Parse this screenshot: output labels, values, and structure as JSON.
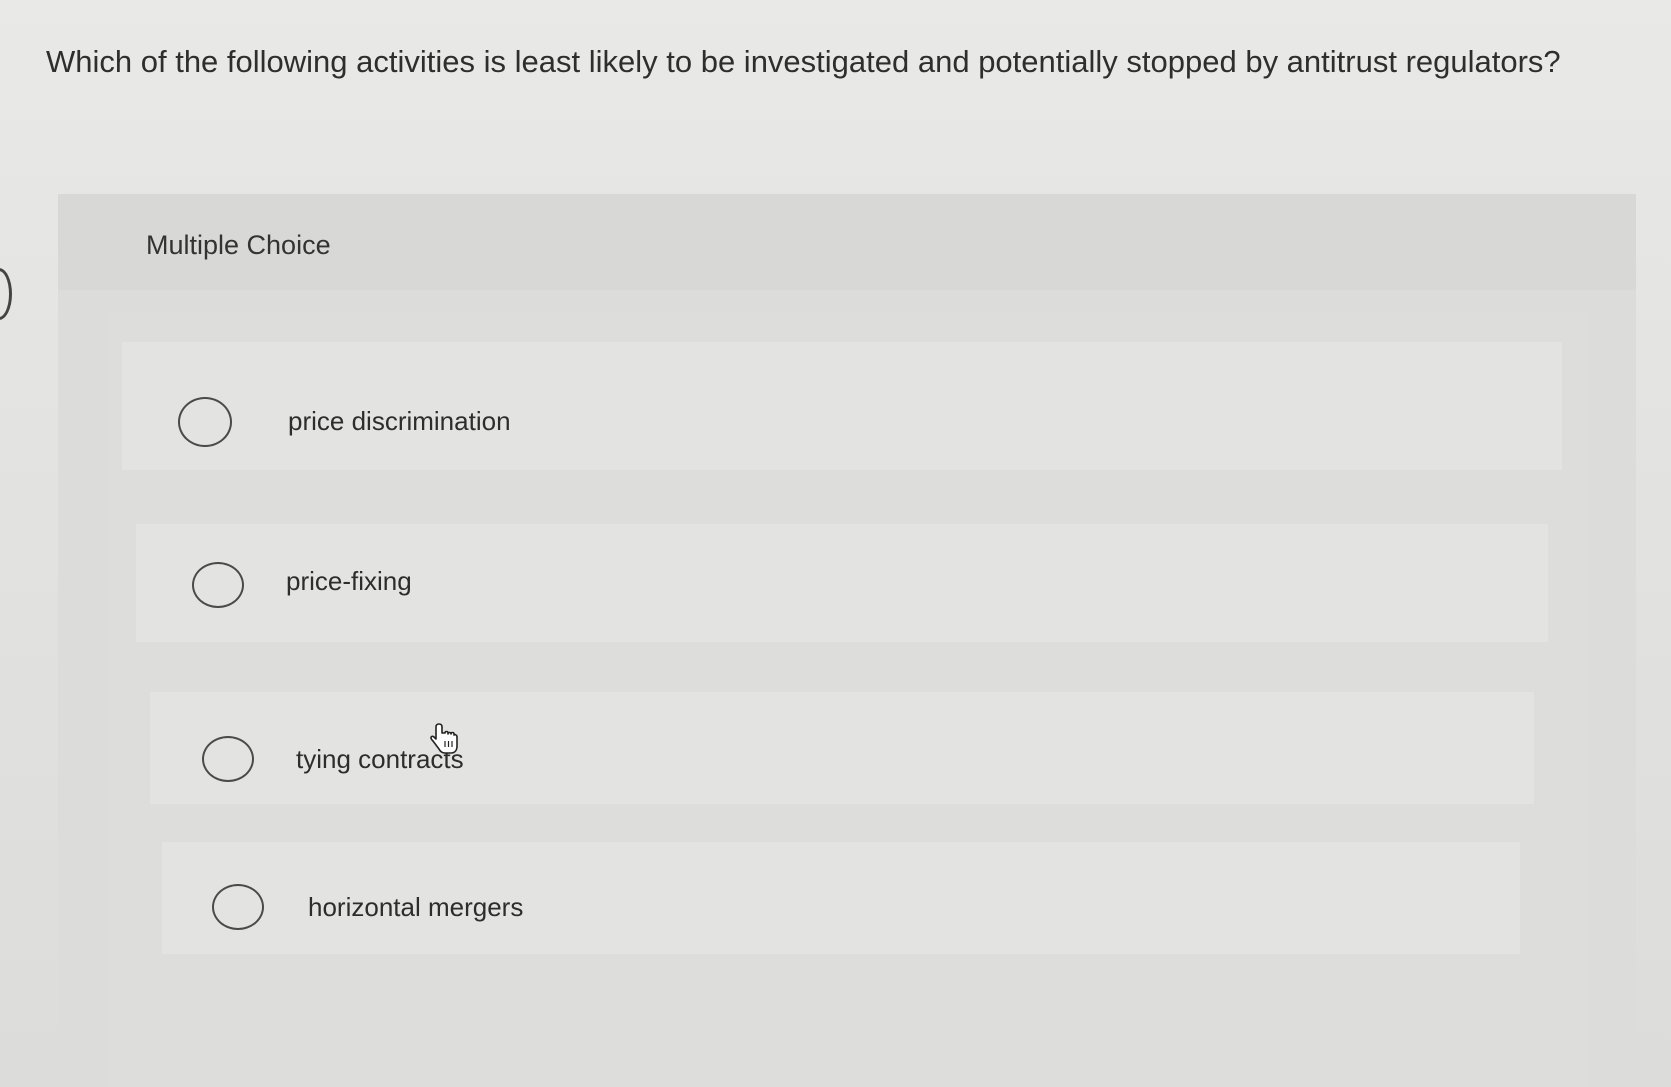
{
  "question": {
    "text": "Which of the following activities is least likely to be investigated and potentially stopped by antitrust regulators?"
  },
  "multiple_choice": {
    "label": "Multiple Choice",
    "options": [
      {
        "label": "price discrimination"
      },
      {
        "label": "price-fixing"
      },
      {
        "label": "tying contracts"
      },
      {
        "label": "horizontal mergers"
      }
    ]
  },
  "cursor": {
    "icon": "hand-pointer-icon"
  }
}
